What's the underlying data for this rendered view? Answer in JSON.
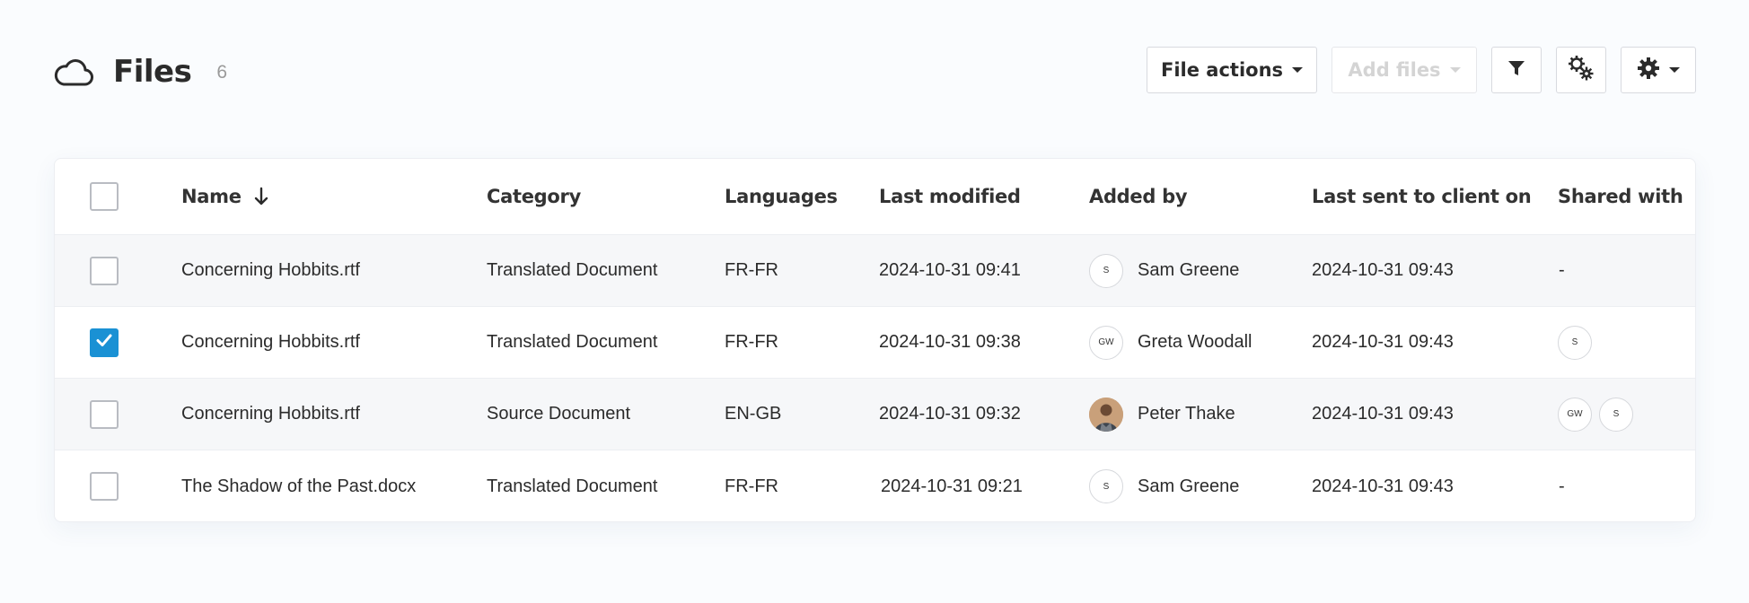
{
  "header": {
    "title": "Files",
    "count": "6",
    "file_actions_label": "File actions",
    "add_files_label": "Add files"
  },
  "colors": {
    "accent": "#1a91d4",
    "border": "#d8dadf",
    "row_alt": "#f6f7f9",
    "muted_text": "#9a9a9a"
  },
  "icons": {
    "title": "cloud-icon",
    "filter": "filter-icon",
    "column_settings": "gears-icon",
    "settings": "gear-icon",
    "sort": "arrow-down-icon"
  },
  "table": {
    "columns": {
      "name": "Name",
      "category": "Category",
      "languages": "Languages",
      "last_modified": "Last modified",
      "added_by": "Added by",
      "last_sent": "Last sent to client on",
      "shared_with": "Shared with"
    },
    "rows": [
      {
        "name": "Concerning Hobbits.rtf",
        "category": "Translated Document",
        "language": "FR-FR",
        "modified": "2024-10-31 09:41",
        "added_by_initials": "S",
        "added_by": "Sam Greene",
        "last_sent": "2024-10-31 09:43",
        "shared": "-",
        "checked": false
      },
      {
        "name": "Concerning Hobbits.rtf",
        "category": "Translated Document",
        "language": "FR-FR",
        "modified": "2024-10-31 09:38",
        "added_by_initials": "GW",
        "added_by": "Greta Woodall",
        "last_sent": "2024-10-31 09:43",
        "shared_avatars": [
          "S"
        ],
        "checked": true
      },
      {
        "name": "Concerning Hobbits.rtf",
        "category": "Source Document",
        "language": "EN-GB",
        "modified": "2024-10-31 09:32",
        "added_by": "Peter Thake",
        "last_sent": "2024-10-31 09:43",
        "shared_avatars": [
          "GW",
          "S"
        ],
        "checked": false
      },
      {
        "name": "The Shadow of the Past.docx",
        "category": "Translated Document",
        "language": "FR-FR",
        "modified": "2024-10-31 09:21",
        "added_by_initials": "S",
        "added_by": "Sam Greene",
        "last_sent": "2024-10-31 09:43",
        "shared": "-",
        "checked": false
      }
    ]
  }
}
